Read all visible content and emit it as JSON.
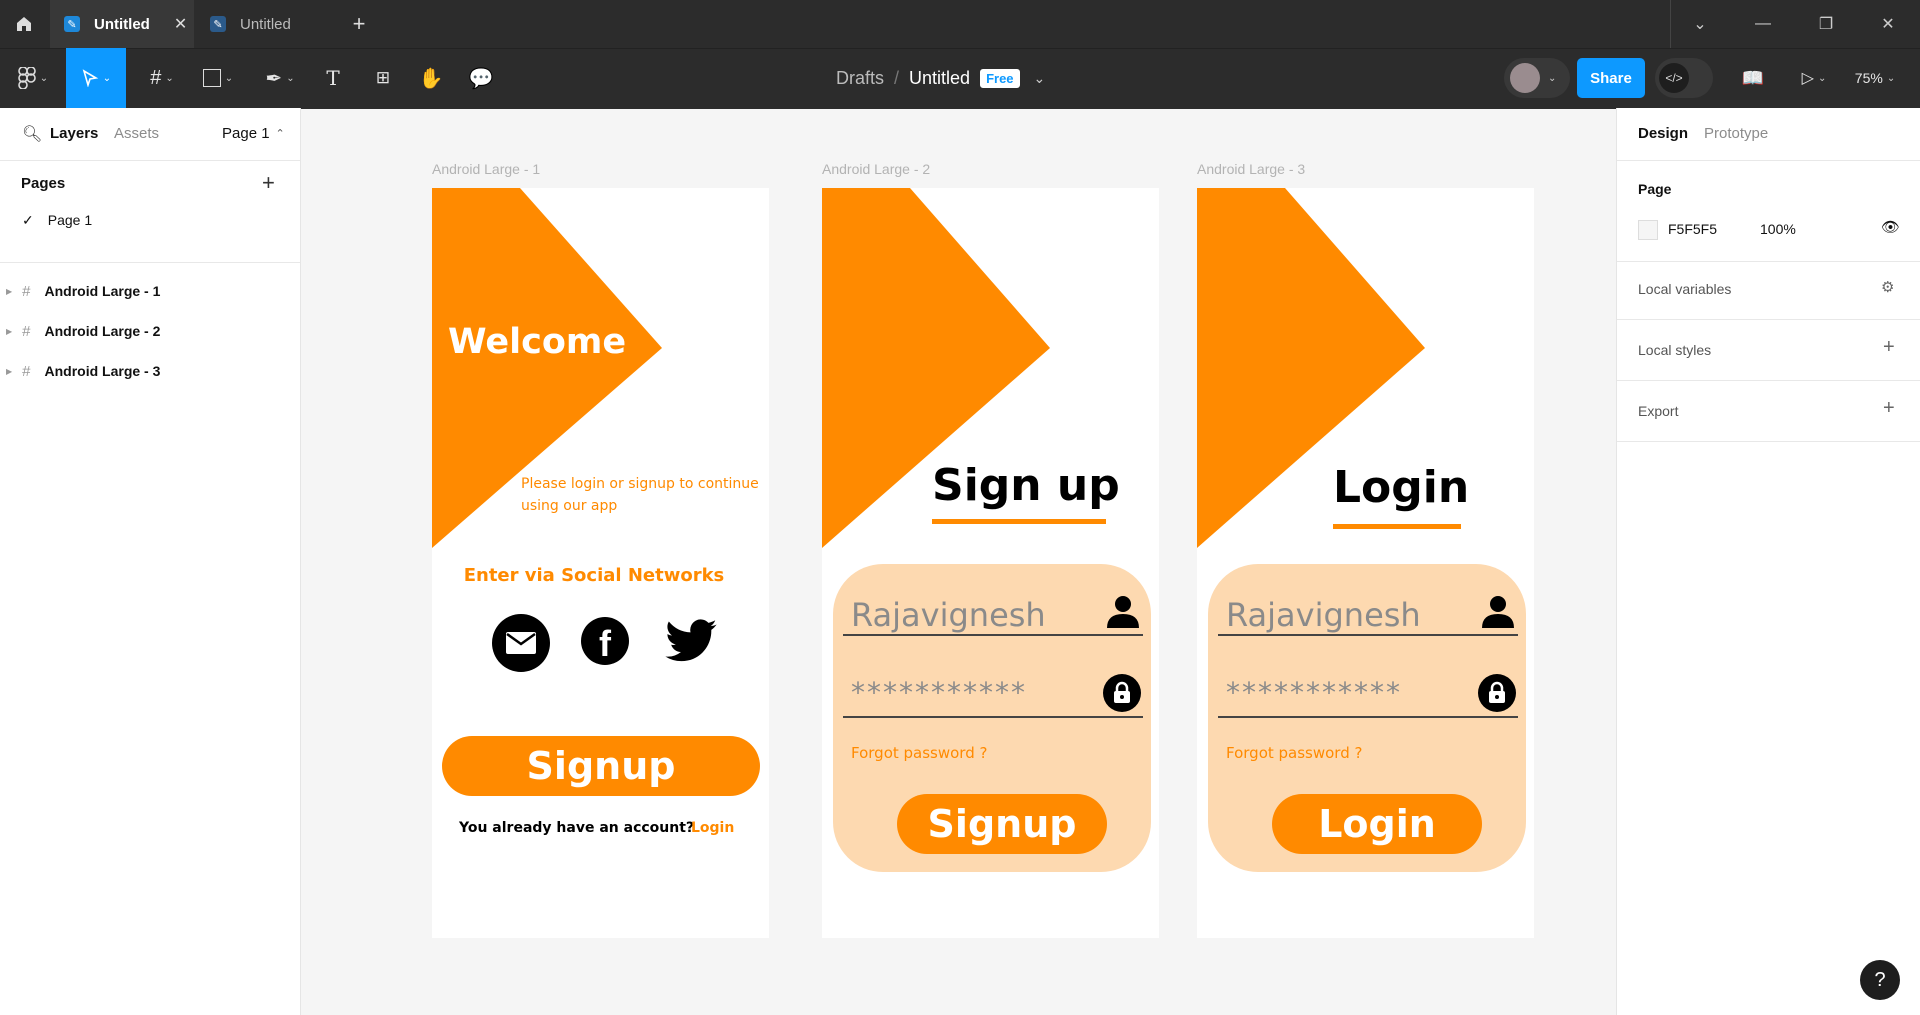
{
  "titlebar": {
    "tabs": [
      {
        "label": "Untitled",
        "active": true
      },
      {
        "label": "Untitled",
        "active": false
      }
    ],
    "new_tab": "+"
  },
  "toolbar": {
    "breadcrumb_parent": "Drafts",
    "breadcrumb_sep": "/",
    "file_name": "Untitled",
    "plan_badge": "Free",
    "share_label": "Share",
    "zoom": "75%"
  },
  "left_panel": {
    "tab_layers": "Layers",
    "tab_assets": "Assets",
    "page_select": "Page 1",
    "pages_heading": "Pages",
    "pages": [
      "Page 1"
    ],
    "layers": [
      "Android Large - 1",
      "Android Large - 2",
      "Android Large - 3"
    ]
  },
  "right_panel": {
    "tab_design": "Design",
    "tab_prototype": "Prototype",
    "page_heading": "Page",
    "page_color": "F5F5F5",
    "page_opacity": "100%",
    "local_variables": "Local variables",
    "local_styles": "Local styles",
    "export": "Export"
  },
  "frames": {
    "f1": {
      "title": "Android Large - 1",
      "welcome": "Welcome",
      "subtitle_line1": "Please login or signup to continue",
      "subtitle_line2": "using our app",
      "social_heading": "Enter via Social Networks",
      "signup_button": "Signup",
      "account_prompt": "You already have an account?",
      "login_link": "Login"
    },
    "f2": {
      "title": "Android Large - 2",
      "heading": "Sign up",
      "username": "Rajavignesh",
      "password": "***********",
      "forgot": "Forgot password ?",
      "button": "Signup"
    },
    "f3": {
      "title": "Android Large - 3",
      "heading": "Login",
      "username": "Rajavignesh",
      "password": "***********",
      "forgot": "Forgot password ?",
      "button": "Login"
    }
  },
  "help": "?",
  "colors": {
    "accent": "#ff8a00",
    "card": "#fdd9b0",
    "share": "#0d99ff"
  }
}
